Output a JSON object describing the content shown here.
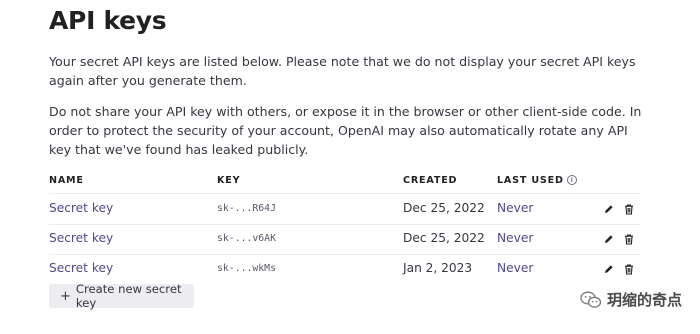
{
  "page": {
    "title": "API keys",
    "paragraph1": "Your secret API keys are listed below. Please note that we do not display your secret API keys again after you generate them.",
    "paragraph2": "Do not share your API key with others, or expose it in the browser or other client-side code. In order to protect the security of your account, OpenAI may also automatically rotate any API key that we've found has leaked publicly."
  },
  "table": {
    "columns": {
      "name": "NAME",
      "key": "KEY",
      "created": "CREATED",
      "last_used": "LAST USED"
    },
    "rows": [
      {
        "name": "Secret key",
        "key": "sk-...R64J",
        "created": "Dec 25, 2022",
        "last_used": "Never"
      },
      {
        "name": "Secret key",
        "key": "sk-...v6AK",
        "created": "Dec 25, 2022",
        "last_used": "Never"
      },
      {
        "name": "Secret key",
        "key": "sk-...wkMs",
        "created": "Jan 2, 2023",
        "last_used": "Never"
      }
    ],
    "icons": {
      "info": "info-icon",
      "edit": "pencil-icon",
      "delete": "trash-icon"
    }
  },
  "actions": {
    "create_label": "Create new secret key",
    "create_icon": "+"
  },
  "watermark": {
    "text": "玥缩的奇点"
  },
  "colors": {
    "link": "#4f4a8a",
    "button_bg": "#ececf1",
    "text": "#353740"
  }
}
